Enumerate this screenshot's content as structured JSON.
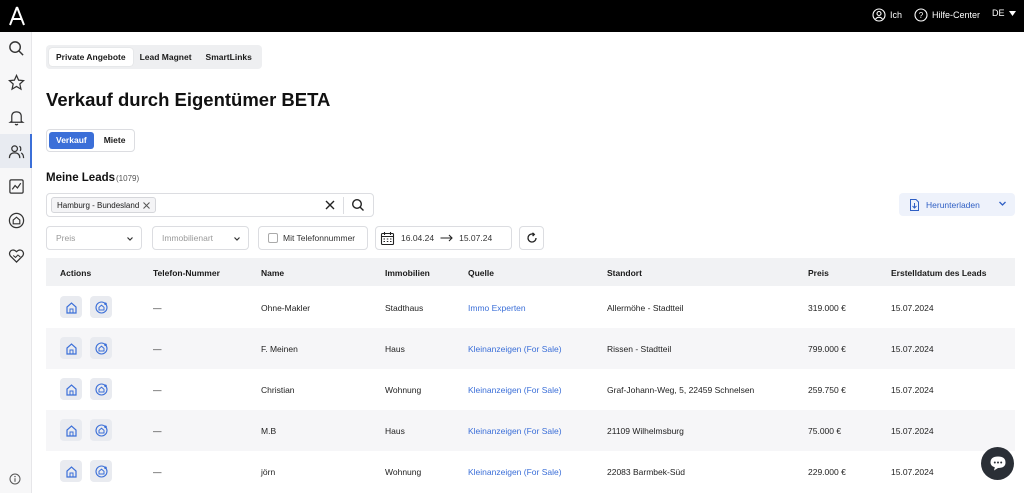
{
  "topbar": {
    "user_label": "Ich",
    "help_label": "Hilfe-Center",
    "lang_label": "DE"
  },
  "nav_tabs": [
    "Private Angebote",
    "Lead Magnet",
    "SmartLinks"
  ],
  "page_title": "Verkauf durch Eigentümer BETA",
  "mode_toggle": {
    "sale": "Verkauf",
    "rent": "Miete"
  },
  "leads": {
    "title": "Meine Leads",
    "count": "(1079)"
  },
  "search": {
    "chip": "Hamburg - Bundesland"
  },
  "download_label": "Herunterladen",
  "filters": {
    "price_placeholder": "Preis",
    "type_placeholder": "Immobilienart",
    "phone_checkbox": "Mit Telefonnummer",
    "date_from": "16.04.24",
    "date_to": "15.07.24"
  },
  "table": {
    "headers": [
      "Actions",
      "Telefon-Nummer",
      "Name",
      "Immobilien",
      "Quelle",
      "Standort",
      "Preis",
      "Erstelldatum des Leads"
    ],
    "rows": [
      {
        "phone": "—",
        "name": "Ohne-Makler",
        "type": "Stadthaus",
        "source": "Immo Experten",
        "location": "Allermöhe - Stadtteil",
        "price": "319.000 €",
        "date": "15.07.2024"
      },
      {
        "phone": "—",
        "name": "F. Meinen",
        "type": "Haus",
        "source": "Kleinanzeigen (For Sale)",
        "location": "Rissen - Stadtteil",
        "price": "799.000 €",
        "date": "15.07.2024"
      },
      {
        "phone": "—",
        "name": "Christian",
        "type": "Wohnung",
        "source": "Kleinanzeigen (For Sale)",
        "location": "Graf-Johann-Weg, 5, 22459 Schnelsen",
        "price": "259.750 €",
        "date": "15.07.2024"
      },
      {
        "phone": "—",
        "name": "M.B",
        "type": "Haus",
        "source": "Kleinanzeigen (For Sale)",
        "location": "21109 Wilhelmsburg",
        "price": "75.000 €",
        "date": "15.07.2024"
      },
      {
        "phone": "—",
        "name": "jörn",
        "type": "Wohnung",
        "source": "Kleinanzeigen (For Sale)",
        "location": "22083 Barmbek-Süd",
        "price": "229.000 €",
        "date": "15.07.2024"
      }
    ]
  },
  "colors": {
    "accent": "#3b6fd8",
    "topbar": "#000000"
  }
}
